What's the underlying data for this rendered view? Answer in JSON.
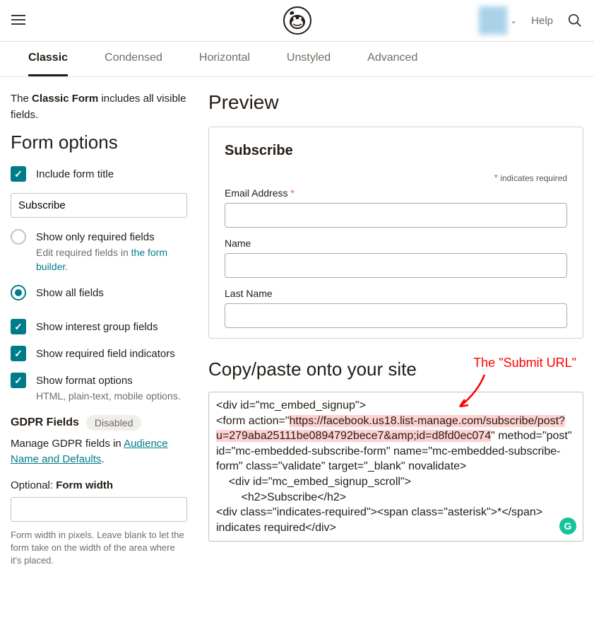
{
  "topbar": {
    "help": "Help"
  },
  "tabs": [
    {
      "label": "Classic",
      "active": true
    },
    {
      "label": "Condensed",
      "active": false
    },
    {
      "label": "Horizontal",
      "active": false
    },
    {
      "label": "Unstyled",
      "active": false
    },
    {
      "label": "Advanced",
      "active": false
    }
  ],
  "sidebar": {
    "intro_pre": "The ",
    "intro_bold": "Classic Form",
    "intro_post": " includes all visible fields.",
    "form_options_title": "Form options",
    "include_title_label": "Include form title",
    "title_value": "Subscribe",
    "show_required_label": "Show only required fields",
    "edit_required_pre": "Edit required fields in ",
    "form_builder_link": "the form builder",
    "show_all_label": "Show all fields",
    "show_interest_label": "Show interest group fields",
    "show_indicators_label": "Show required field indicators",
    "show_format_label": "Show format options",
    "format_sub": "HTML, plain-text, mobile options.",
    "gdpr_title": "GDPR Fields",
    "gdpr_badge": "Disabled",
    "gdpr_manage_pre": "Manage GDPR fields in ",
    "gdpr_link": "Audience Name and Defaults",
    "optional_pre": "Optional: ",
    "optional_bold": "Form width",
    "width_help": "Form width in pixels. Leave blank to let the form take on the width of the area where it's placed."
  },
  "preview": {
    "title": "Preview",
    "subscribe_heading": "Subscribe",
    "req_note": " indicates required",
    "fields": [
      {
        "label": "Email Address",
        "required": true
      },
      {
        "label": "Name",
        "required": false
      },
      {
        "label": "Last Name",
        "required": false
      }
    ]
  },
  "copy": {
    "title": "Copy/paste onto your site",
    "annotation": "The \"Submit URL\"",
    "code_pre": "<div id=\"mc_embed_signup\">\n<form action=\"",
    "code_highlight": "https://facebook.us18.list-manage.com/subscribe/post?u=279aba25111be0894792bece7&amp;id=d8fd0ec074",
    "code_post": "\" method=\"post\" id=\"mc-embedded-subscribe-form\" name=\"mc-embedded-subscribe-form\" class=\"validate\" target=\"_blank\" novalidate>\n    <div id=\"mc_embed_signup_scroll\">\n        <h2>Subscribe</h2>\n<div class=\"indicates-required\"><span class=\"asterisk\">*</span> indicates required</div>"
  }
}
